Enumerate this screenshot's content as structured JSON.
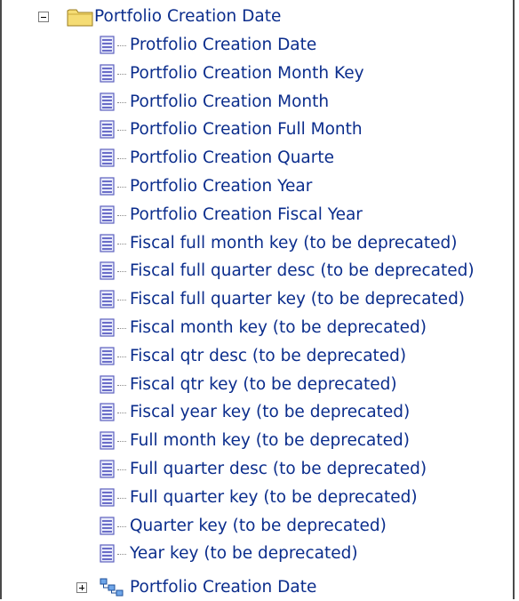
{
  "tree": {
    "folder_label": "Portfolio Creation Date",
    "columns": [
      "Protfolio Creation Date",
      "Portfolio Creation Month Key",
      "Portfolio Creation Month",
      "Portfolio Creation Full Month",
      "Portfolio Creation Quarte",
      "Portfolio Creation Year",
      "Portfolio Creation Fiscal Year",
      "Fiscal full month key (to be deprecated)",
      "Fiscal full quarter desc (to be deprecated)",
      "Fiscal full quarter key (to be deprecated)",
      "Fiscal month key (to be deprecated)",
      "Fiscal qtr desc (to be deprecated)",
      "Fiscal qtr key (to be deprecated)",
      "Fiscal year key (to be deprecated)",
      "Full month key (to be deprecated)",
      "Full quarter desc (to be deprecated)",
      "Full quarter key (to be deprecated)",
      "Quarter key (to be deprecated)",
      "Year key (to be deprecated)"
    ],
    "hierarchy_label": "Portfolio Creation Date"
  },
  "icons": {
    "folder": "folder-icon",
    "column": "logical-column-icon",
    "hierarchy": "hierarchy-icon",
    "collapse": "collapse-icon",
    "expand": "expand-icon"
  },
  "colors": {
    "text": "#0b2d8c",
    "folder_fill": "#f5dc74",
    "column_icon": "#6a6dc8",
    "border": "#4a4a4a"
  }
}
